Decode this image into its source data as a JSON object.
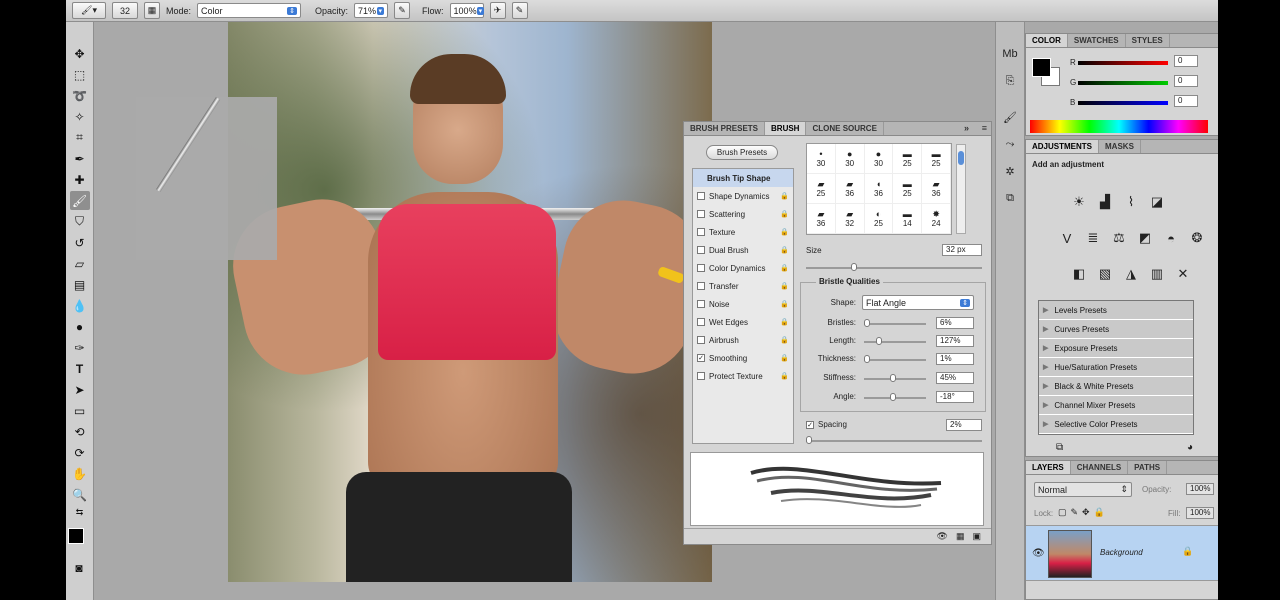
{
  "options_bar": {
    "brush_size": "32",
    "mode_label": "Mode:",
    "mode_value": "Color",
    "opacity_label": "Opacity:",
    "opacity_value": "71%",
    "flow_label": "Flow:",
    "flow_value": "100%"
  },
  "brush_panel": {
    "tabs": [
      "BRUSH PRESETS",
      "BRUSH",
      "CLONE SOURCE"
    ],
    "active_tab": "BRUSH",
    "presets_button": "Brush Presets",
    "selected_item": "Brush Tip Shape",
    "options": [
      {
        "label": "Shape Dynamics",
        "checked": false
      },
      {
        "label": "Scattering",
        "checked": false
      },
      {
        "label": "Texture",
        "checked": false
      },
      {
        "label": "Dual Brush",
        "checked": false
      },
      {
        "label": "Color Dynamics",
        "checked": false
      },
      {
        "label": "Transfer",
        "checked": false
      },
      {
        "label": "Noise",
        "checked": false
      },
      {
        "label": "Wet Edges",
        "checked": false
      },
      {
        "label": "Airbrush",
        "checked": false
      },
      {
        "label": "Smoothing",
        "checked": true
      },
      {
        "label": "Protect Texture",
        "checked": false
      }
    ],
    "tip_sizes": [
      "30",
      "30",
      "30",
      "25",
      "25",
      "25",
      "36",
      "36",
      "25",
      "36",
      "36",
      "32",
      "25",
      "14",
      "24"
    ],
    "size_label": "Size",
    "size_value": "32 px",
    "bristle_title": "Bristle Qualities",
    "shape_label": "Shape:",
    "shape_value": "Flat Angle",
    "bristles_label": "Bristles:",
    "bristles_value": "6%",
    "length_label": "Length:",
    "length_value": "127%",
    "thickness_label": "Thickness:",
    "thickness_value": "1%",
    "stiffness_label": "Stiffness:",
    "stiffness_value": "45%",
    "angle_label": "Angle:",
    "angle_value": "-18°",
    "spacing_label": "Spacing",
    "spacing_value": "2%"
  },
  "color_panel": {
    "tabs": [
      "COLOR",
      "SWATCHES",
      "STYLES"
    ],
    "r_label": "R",
    "r_value": "0",
    "g_label": "G",
    "g_value": "0",
    "b_label": "B",
    "b_value": "0"
  },
  "adjustments_panel": {
    "tabs": [
      "ADJUSTMENTS",
      "MASKS"
    ],
    "heading": "Add an adjustment",
    "presets": [
      "Levels Presets",
      "Curves Presets",
      "Exposure Presets",
      "Hue/Saturation Presets",
      "Black & White Presets",
      "Channel Mixer Presets",
      "Selective Color Presets"
    ]
  },
  "layers_panel": {
    "tabs": [
      "LAYERS",
      "CHANNELS",
      "PATHS"
    ],
    "blend_mode": "Normal",
    "opacity_label": "Opacity:",
    "opacity_value": "100%",
    "lock_label": "Lock:",
    "fill_label": "Fill:",
    "fill_value": "100%",
    "layer_name": "Background"
  }
}
